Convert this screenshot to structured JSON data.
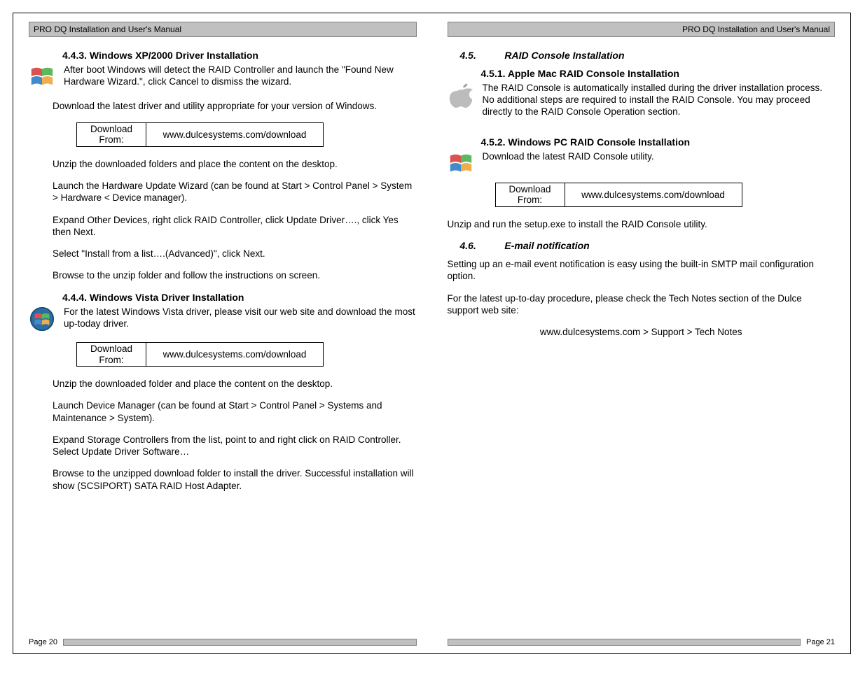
{
  "header": {
    "left": "PRO DQ Installation and User's Manual",
    "right": "PRO DQ Installation and User's Manual"
  },
  "left": {
    "s443": {
      "title": "4.4.3. Windows XP/2000 Driver Installation",
      "p1": "After boot Windows will detect the RAID Controller and launch the \"Found New Hardware Wizard.\", click Cancel to dismiss the wizard.",
      "p2": "Download the latest driver and utility appropriate for your version of Windows.",
      "dl_label": "Download\nFrom:",
      "dl_url": "www.dulcesystems.com/download",
      "p3": "Unzip the downloaded folders and place the content on the desktop.",
      "p4": "Launch the Hardware Update Wizard (can be found at Start > Control Panel > System > Hardware < Device manager).",
      "p5": "Expand Other Devices, right click RAID Controller, click Update Driver…., click Yes then Next.",
      "p6": "Select \"Install from a list….(Advanced)\", click Next.",
      "p7": "Browse to the unzip folder and follow the instructions on screen."
    },
    "s444": {
      "title": "4.4.4. Windows Vista Driver Installation",
      "p1": "For the latest Windows Vista driver, please visit our web site and download the most up-today driver.",
      "dl_label": "Download\nFrom:",
      "dl_url": "www.dulcesystems.com/download",
      "p2": "Unzip the downloaded folder and place the content on the desktop.",
      "p3": "Launch Device Manager (can be found at Start > Control Panel > Systems and Maintenance > System).",
      "p4": "Expand Storage Controllers from the list, point to and right click on RAID Controller.   Select Update Driver Software…",
      "p5": "Browse to the unzipped download folder to install the driver.  Successful installation will show (SCSIPORT) SATA RAID Host Adapter."
    },
    "page": "Page 20"
  },
  "right": {
    "s45": {
      "num": "4.5.",
      "title": "RAID Console Installation"
    },
    "s451": {
      "title": "4.5.1. Apple Mac RAID Console Installation",
      "p1": "The RAID Console is automatically installed during the driver installation process.  No additional steps are required to install the RAID Console.  You may proceed directly to the RAID Console Operation section."
    },
    "s452": {
      "title": "4.5.2. Windows PC RAID Console Installation",
      "p1": "Download the latest RAID Console utility.",
      "dl_label": "Download\nFrom:",
      "dl_url": "www.dulcesystems.com/download",
      "p2": "Unzip and run the setup.exe to install the RAID Console utility."
    },
    "s46": {
      "num": "4.6.",
      "title": "E-mail notification",
      "p1": "Setting up an e-mail event notification is easy using the built-in SMTP mail configuration option.",
      "p2": "For the latest up-to-day procedure, please check the Tech Notes section of the Dulce support web site:",
      "p3": "www.dulcesystems.com > Support > Tech Notes"
    },
    "page": "Page 21"
  }
}
